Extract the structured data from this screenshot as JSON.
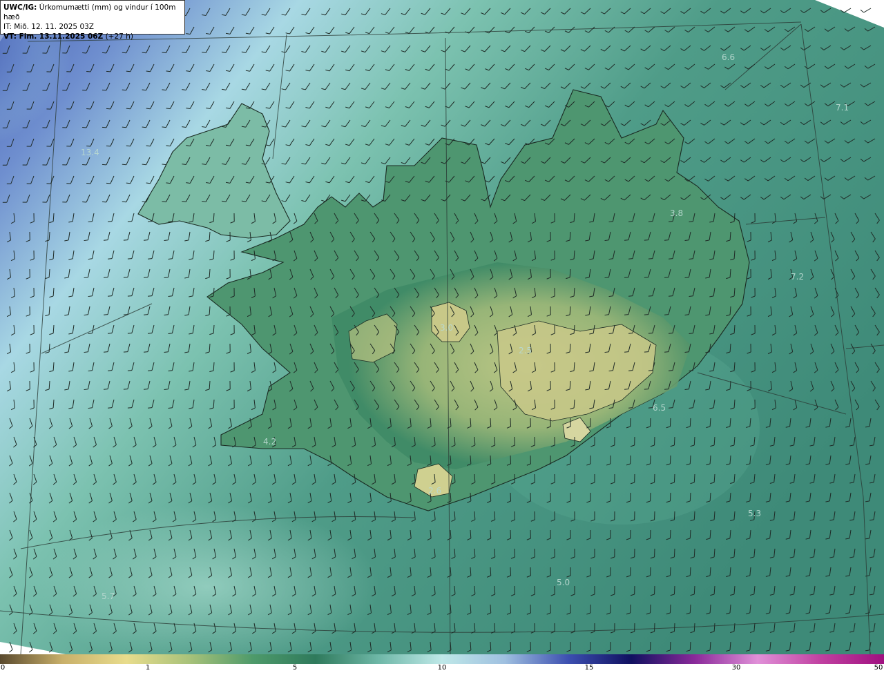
{
  "info": {
    "title_bold": "UWC/IG:",
    "title_rest": " Úrkomumætti (mm) og vindur í 100m hæð",
    "init_time": "IT: Mið. 12. 11. 2025 03Z",
    "valid_bold": "VT: Fim. 13.11.2025 06Z",
    "valid_rest": " (+27 h)"
  },
  "map_labels": [
    "13.4",
    "6.6",
    "7.1",
    "3.8",
    "7.2",
    "3.0",
    "2.5",
    "6.5",
    "4.2",
    "2.6",
    "5.3",
    "5.0",
    "5.7"
  ],
  "colorbar": {
    "ticks": [
      "0",
      "1",
      "5",
      "10",
      "15",
      "30",
      "50"
    ],
    "colors": [
      "#5a4a2e",
      "#c9b06a",
      "#e8dc8c",
      "#a8c27a",
      "#4e9a6a",
      "#2f7a5c",
      "#6fb8a8",
      "#bfe8e8",
      "#9fc0e0",
      "#3c4fb0",
      "#101060",
      "#8a2a9a",
      "#e090d8",
      "#c040a0",
      "#a01080"
    ]
  },
  "colors": {
    "sea": "#4b9a84",
    "land": "#5c9a6e",
    "interior": "#b8c684",
    "high_precip": "#4058b0"
  }
}
